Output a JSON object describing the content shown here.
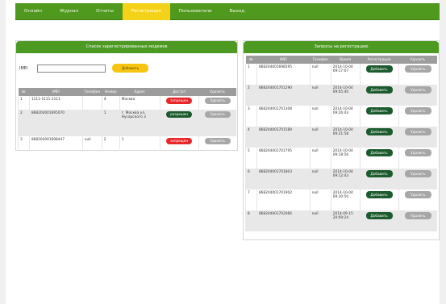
{
  "nav": {
    "items": [
      {
        "label": "Онлайн"
      },
      {
        "label": "Журнал"
      },
      {
        "label": "Отчеты"
      },
      {
        "label": "Регистрация"
      },
      {
        "label": "Пользователи"
      },
      {
        "label": "Выход"
      }
    ],
    "active_index": 3
  },
  "left_panel": {
    "title": "Список зарегистрированных модемов",
    "imei_label": "IMEI",
    "imei_value": "",
    "add_button": "Добавить",
    "columns": [
      "№",
      "IMEI",
      "Телефон",
      "Номер",
      "Адрес",
      "Доступ",
      "Удалить"
    ],
    "rows": [
      {
        "num": "1",
        "imei": "1111-1111-1111",
        "phone": "",
        "number": "4",
        "address": "Москва",
        "access": "запрещен",
        "access_state": "forbidden",
        "delete": "Удалить"
      },
      {
        "num": "2",
        "imei": "868204001695070",
        "phone": "",
        "number": "1",
        "address": "г. Москва ул. Нусарского 3",
        "access": "разрешен",
        "access_state": "allowed",
        "delete": "Удалить"
      },
      {
        "num": "3",
        "imei": "868204001698447",
        "phone": "null",
        "number": "2",
        "address": "1",
        "access": "запрещен",
        "access_state": "forbidden",
        "delete": "Удалить"
      }
    ]
  },
  "right_panel": {
    "title": "Запросы на регистрацию",
    "columns": [
      "№",
      "IMEI",
      "Телефон",
      "Время",
      "Регистрация",
      "Удалить"
    ],
    "rows": [
      {
        "num": "1",
        "imei": "868204001698595",
        "phone": "null",
        "time": "2014-10-04 09:17:07",
        "register": "Добавить",
        "remove": "Удалить"
      },
      {
        "num": "2",
        "imei": "868204001701290",
        "phone": "null",
        "time": "2014-10-04 09:05:40",
        "register": "Добавить",
        "remove": "Удалить"
      },
      {
        "num": "3",
        "imei": "868204001701308",
        "phone": "null",
        "time": "2014-10-04 09:26:43",
        "register": "Добавить",
        "remove": "Удалить"
      },
      {
        "num": "4",
        "imei": "868204001701589",
        "phone": "null",
        "time": "2014-10-04 09:21:58",
        "register": "Добавить",
        "remove": "Удалить"
      },
      {
        "num": "5",
        "imei": "868204001701795",
        "phone": "null",
        "time": "2014-10-04 09:18:56",
        "register": "Добавить",
        "remove": "Удалить"
      },
      {
        "num": "6",
        "imei": "868204001701803",
        "phone": "null",
        "time": "2014-10-04 09:12:43",
        "register": "Добавить",
        "remove": "Удалить"
      },
      {
        "num": "7",
        "imei": "868204001701902",
        "phone": "null",
        "time": "2014-10-04 09:30:50",
        "register": "Добавить",
        "remove": "Удалить"
      },
      {
        "num": "8",
        "imei": "868204001702066",
        "phone": "null",
        "time": "2014-09-15 20:09:24",
        "register": "Добавить",
        "remove": "Удалить"
      }
    ]
  },
  "colors": {
    "nav_green": "#4f9a1e",
    "nav_active": "#f5d21a",
    "header_green": "#4c9a21",
    "forbidden": "#e8262a",
    "allowed": "#1b5b2e",
    "add_yellow": "#f5c512"
  }
}
